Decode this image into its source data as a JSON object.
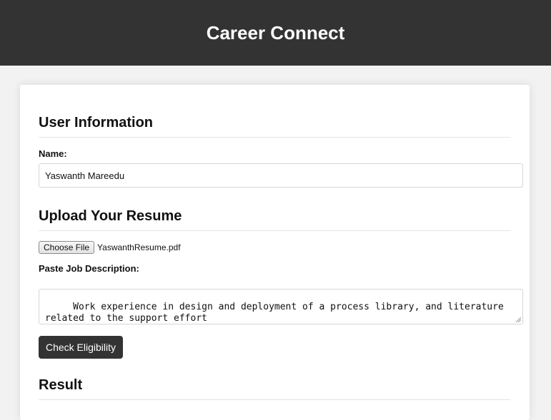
{
  "header": {
    "title": "Career Connect",
    "bg_color": "#333333"
  },
  "user_info": {
    "title": "User Information",
    "name_label": "Name:",
    "name_value": "Yaswanth Mareedu"
  },
  "upload": {
    "title": "Upload Your Resume",
    "choose_file_label": "Choose File",
    "file_name": "YaswanthResume.pdf",
    "jd_label": "Paste Job Description:",
    "jd_value": " Work experience in design and deployment of a process library, and literature\nrelated to the support effort\n Experience developing articles, quick reference guides, and videos",
    "check_button_label": "Check Eligibility"
  },
  "result": {
    "title": "Result"
  }
}
